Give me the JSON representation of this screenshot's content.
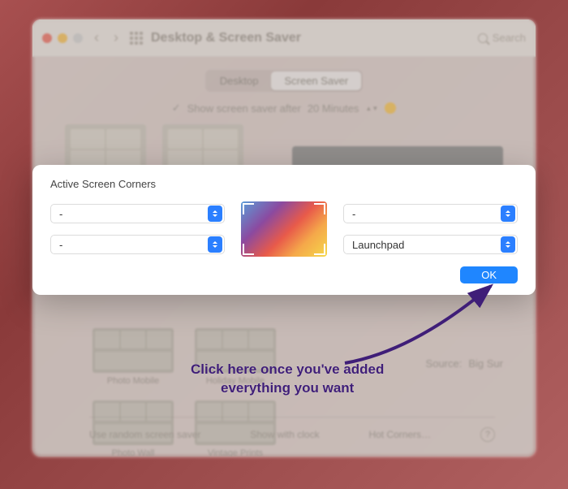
{
  "window": {
    "title": "Desktop & Screen Saver",
    "search_placeholder": "Search",
    "tabs": {
      "left": "Desktop",
      "right": "Screen Saver"
    },
    "after_row": {
      "check": "✓",
      "label": "Show screen saver after",
      "value": "20 Minutes"
    },
    "source_label": "Source:",
    "source_value": "Big Sur",
    "thumb_labels": [
      "Photo Mobile",
      "Holiday Mobile",
      "Photo Wall",
      "Vintage Prints"
    ],
    "footer": {
      "random": "Use random screen saver",
      "clock": "Show with clock",
      "hot": "Hot Corners…",
      "help": "?"
    }
  },
  "modal": {
    "title": "Active Screen Corners",
    "corners": {
      "top_left": "-",
      "bottom_left": "-",
      "top_right": "-",
      "bottom_right": "Launchpad"
    },
    "ok_label": "OK"
  },
  "callout": {
    "line1": "Click here once you've added",
    "line2": "everything you want"
  }
}
